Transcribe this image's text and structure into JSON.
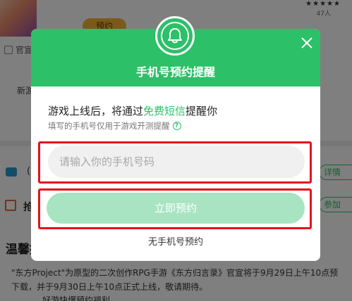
{
  "background": {
    "reserve_pill": "预约",
    "rating_stars": "★★★★★",
    "rating_count": "47人",
    "official_label": "官宣",
    "new_label": "新游",
    "chat_label": "(",
    "detail_button": "详情",
    "gift_label": "抢",
    "join_button": "参加",
    "warm_title": "温馨提",
    "description": "\"东方Project\"为原型的二次创作RPG手游《东方归言录》官宣将于9月29日上午10点预下载，并于9月30日上午10点正式上线，敬请期待。",
    "description_tail": "好游快爆预约福利"
  },
  "dialog": {
    "title": "手机号预约提醒",
    "info_prefix": "游戏上线后，将通过",
    "info_highlight": "免费短信",
    "info_suffix": "提醒你",
    "sub_info": "填写的手机号仅用于游戏开测提醒",
    "help_icon_glyph": "?",
    "phone_placeholder": "请输入你的手机号码",
    "submit_label": "立即预约",
    "no_phone_label": "无手机号预约"
  },
  "colors": {
    "brand_green": "#2cc068",
    "disabled_green": "#a8e4c2",
    "highlight_red": "#e3131a",
    "reserve_orange": "#f5b437"
  },
  "icons": {
    "header": "bell-icon",
    "close": "close-icon",
    "help": "question-circle-icon"
  }
}
